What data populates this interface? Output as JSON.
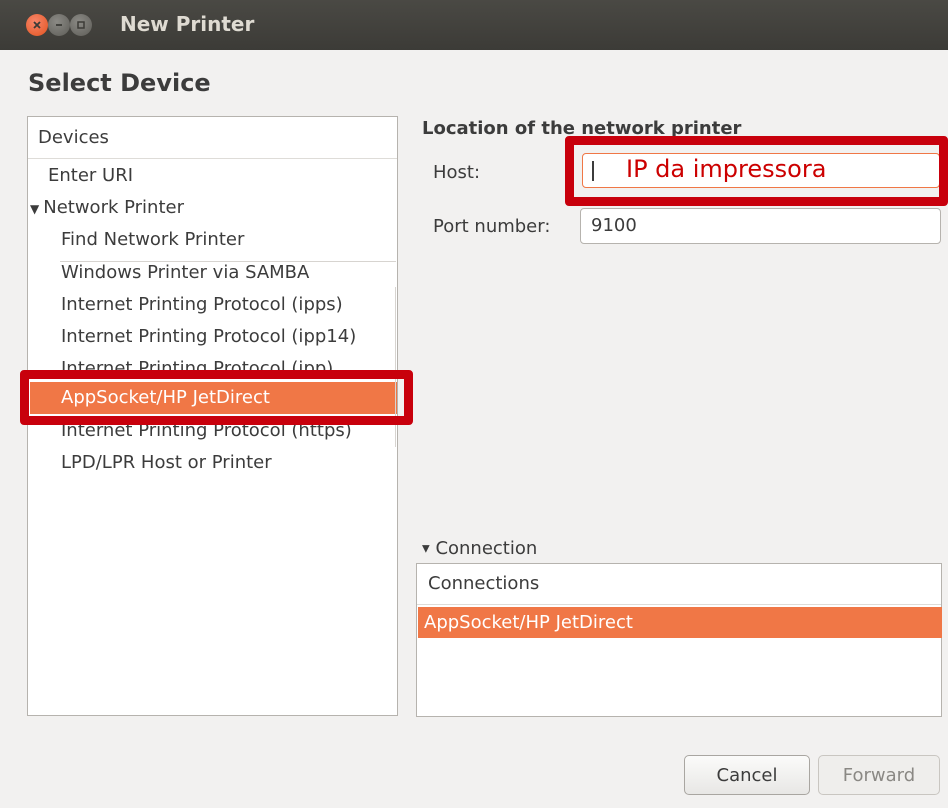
{
  "window": {
    "title": "New Printer"
  },
  "heading": "Select Device",
  "devices": {
    "header": "Devices",
    "items": [
      "Enter URI",
      "Network Printer",
      "Find Network Printer",
      "Windows Printer via SAMBA",
      "Internet Printing Protocol (ipps)",
      "Internet Printing Protocol (ipp14)",
      "Internet Printing Protocol (ipp)",
      "AppSocket/HP JetDirect",
      "Internet Printing Protocol (https)",
      "LPD/LPR Host or Printer"
    ],
    "selected": "AppSocket/HP JetDirect"
  },
  "location": {
    "title": "Location of the network printer",
    "host_label": "Host:",
    "host_value": "",
    "host_annotation": "IP da impressora",
    "port_label": "Port number:",
    "port_value": "9100"
  },
  "connection": {
    "toggle_label": "Connection",
    "header": "Connections",
    "selected": "AppSocket/HP JetDirect"
  },
  "buttons": {
    "cancel": "Cancel",
    "forward": "Forward"
  },
  "colors": {
    "accent": "#f07746",
    "highlight_box": "#c8000c"
  }
}
